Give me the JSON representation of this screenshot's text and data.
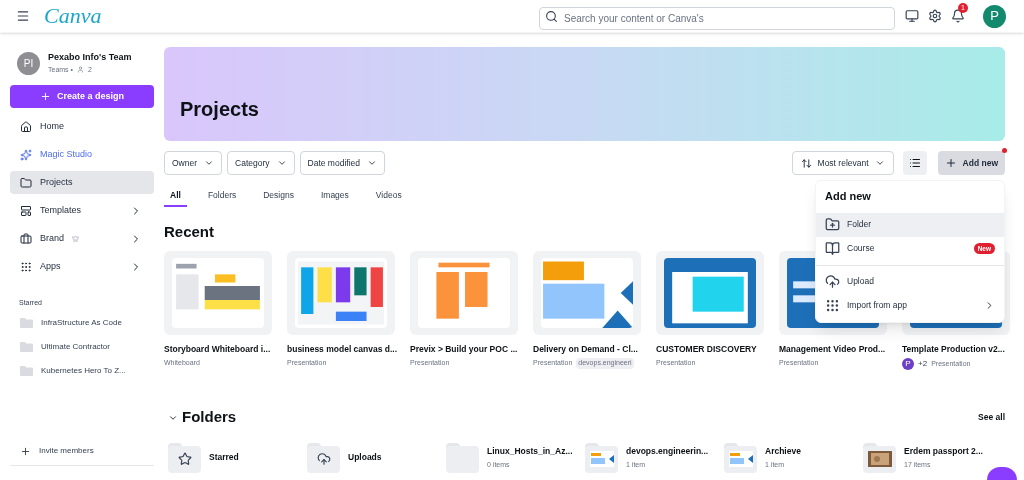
{
  "header": {
    "logo": "Canva",
    "search": {
      "placeholder": "Search your content or Canva's"
    },
    "notification_count": "1",
    "avatar": "P"
  },
  "sidebar": {
    "team": {
      "initials": "PI",
      "name": "Pexabo Info's Team",
      "plan": "Teams •",
      "members": "2"
    },
    "create_button": "Create a design",
    "items": [
      {
        "label": "Home",
        "kind": "plain",
        "selected": false,
        "chevron": false
      },
      {
        "label": "Magic Studio",
        "kind": "magic",
        "selected": false,
        "chevron": false
      },
      {
        "label": "Projects",
        "kind": "plain",
        "selected": true,
        "chevron": false
      },
      {
        "label": "Templates",
        "kind": "plain",
        "selected": false,
        "chevron": true
      },
      {
        "label": "Brand",
        "kind": "crown",
        "selected": false,
        "chevron": true
      },
      {
        "label": "Apps",
        "kind": "plain",
        "selected": false,
        "chevron": true
      }
    ],
    "starred_title": "Starred",
    "starred": [
      "InfraStructure As Code",
      "Ultimate Contractor",
      "Kubernetes Hero To Z..."
    ],
    "invite": "Invite members"
  },
  "banner": {
    "title": "Projects"
  },
  "filters": [
    "Owner",
    "Category",
    "Date modified"
  ],
  "sort": "Most relevant",
  "add_new": {
    "label": "Add new",
    "dot": true
  },
  "tabs": [
    {
      "label": "All",
      "selected": true
    },
    {
      "label": "Folders",
      "selected": false
    },
    {
      "label": "Designs",
      "selected": false
    },
    {
      "label": "Images",
      "selected": false
    },
    {
      "label": "Videos",
      "selected": false
    }
  ],
  "recent": {
    "title": "Recent",
    "items": [
      {
        "title": "Storyboard Whiteboard i...",
        "type": "Whiteboard"
      },
      {
        "title": "business model canvas d...",
        "type": "Presentation"
      },
      {
        "title": "Previx > Build your  POC ...",
        "type": "Presentation"
      },
      {
        "title": "Delivery on Demand  - Cl...",
        "type": "Presentation",
        "tag": "devops.engineeri"
      },
      {
        "title": "CUSTOMER DISCOVERY",
        "type": "Presentation"
      },
      {
        "title": "Management Video Prod...",
        "type": "Presentation"
      },
      {
        "title": "Template  Production v2...",
        "type": "Presentation",
        "avatar": "P",
        "extra": "+2"
      }
    ]
  },
  "folders": {
    "title": "Folders",
    "expanded": true,
    "see_all": "See all",
    "items": [
      {
        "name": "Starred",
        "kind": "starred"
      },
      {
        "name": "Uploads",
        "kind": "uploads"
      },
      {
        "name": "Linux_Hosts_in_Az...",
        "count": "0 items",
        "kind": "plain"
      },
      {
        "name": "devops.engineerin...",
        "count": "1 item",
        "kind": "thumb"
      },
      {
        "name": "Archieve",
        "count": "1 item",
        "kind": "thumb"
      },
      {
        "name": "Erdem passport 2...",
        "count": "17 items"
      }
    ]
  },
  "menu": {
    "title": "Add new",
    "items": [
      {
        "label": "Folder",
        "kind": "folder",
        "selected": true,
        "chevron": false
      },
      {
        "label": "Course",
        "kind": "course",
        "selected": false,
        "badge": "New",
        "chevron": false
      },
      {
        "label": "Upload",
        "kind": "upload",
        "selected": false,
        "chevron": false
      },
      {
        "label": "Import from app",
        "kind": "apps",
        "selected": false,
        "chevron": true
      }
    ]
  }
}
